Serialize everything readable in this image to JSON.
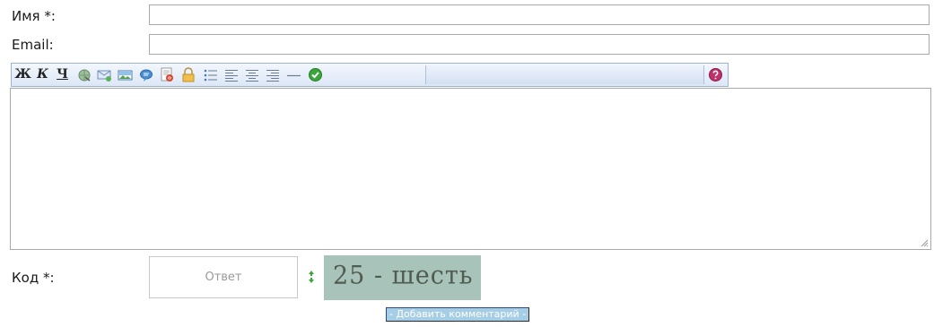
{
  "form": {
    "name_label": "Имя *:",
    "name_value": "",
    "email_label": "Email:",
    "email_value": "",
    "comment_value": "",
    "code_label": "Код *:",
    "code_placeholder": "Ответ",
    "captcha_text": "25 - шесть",
    "submit_label": "- Добавить комментарий -"
  },
  "toolbar": {
    "bold_glyph": "Ж",
    "italic_glyph": "К",
    "underline_glyph": "Ч",
    "buttons": [
      "bold-icon",
      "italic-icon",
      "underline-icon",
      "link-icon",
      "email-icon",
      "image-icon",
      "quote-icon",
      "code-icon",
      "hide-icon",
      "list-icon",
      "align-left-icon",
      "align-center-icon",
      "align-right-icon",
      "horizontal-rule-icon",
      "check-icon",
      "help-icon"
    ]
  },
  "colors": {
    "toolbar_border": "#9fb3cf",
    "captcha_bg": "#a7c3ba",
    "submit_bg": "#a5cde6",
    "check_green": "#3aa63a",
    "help_magenta": "#c0306a"
  }
}
